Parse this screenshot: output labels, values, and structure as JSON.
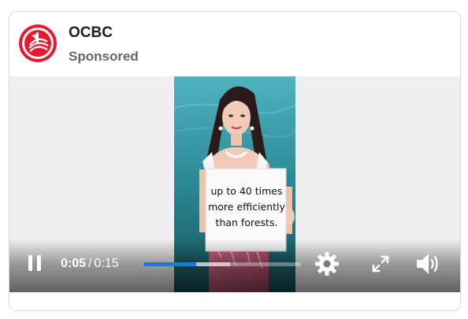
{
  "post": {
    "advertiser": "OCBC",
    "label": "Sponsored",
    "brand_color": "#e8192c"
  },
  "video": {
    "sign_lines": [
      "up to 40 times",
      "more efficiently",
      "than forests."
    ],
    "current_time": "0:05",
    "separator": "/",
    "duration": "0:15",
    "progress_fraction": 0.333,
    "buffered_fraction": 0.55,
    "progress_color": "#1877f2",
    "icons": {
      "pause": "pause-icon",
      "settings": "gear-icon",
      "fullscreen": "fullscreen-icon",
      "volume": "volume-icon"
    }
  }
}
